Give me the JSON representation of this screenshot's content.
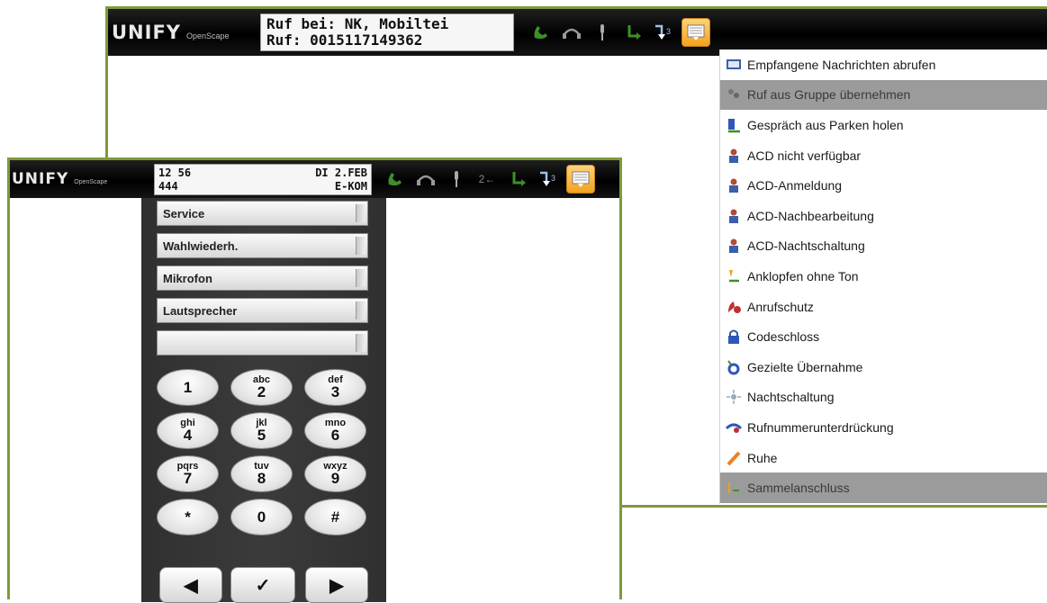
{
  "back_window": {
    "logo_brand": "UNIFY",
    "logo_sub": "OpenScape",
    "display": [
      "Ruf bei: NK, Mobiltei",
      "Ruf: 0015117149362"
    ],
    "toolbar_icons": [
      "phone-handset-icon",
      "headset-icon",
      "microphone-icon",
      "call-transfer-icon",
      "call-forward-icon",
      "menu-icon"
    ]
  },
  "dropdown_menu": {
    "items": [
      {
        "label": "Empfangene Nachrichten abrufen",
        "icon": "messages-icon",
        "enabled": true
      },
      {
        "label": "Ruf aus Gruppe übernehmen",
        "icon": "group-pickup-icon",
        "enabled": false
      },
      {
        "label": "Gespräch aus Parken holen",
        "icon": "park-retrieve-icon",
        "enabled": true
      },
      {
        "label": "ACD nicht verfügbar",
        "icon": "acd-agent-icon",
        "enabled": true
      },
      {
        "label": "ACD-Anmeldung",
        "icon": "acd-agent-icon",
        "enabled": true
      },
      {
        "label": "ACD-Nachbearbeitung",
        "icon": "acd-agent-icon",
        "enabled": true
      },
      {
        "label": "ACD-Nachtschaltung",
        "icon": "acd-agent-icon",
        "enabled": true
      },
      {
        "label": "Anklopfen ohne Ton",
        "icon": "call-waiting-icon",
        "enabled": true
      },
      {
        "label": "Anrufschutz",
        "icon": "do-not-disturb-icon",
        "enabled": true
      },
      {
        "label": "Codeschloss",
        "icon": "lock-icon",
        "enabled": true
      },
      {
        "label": "Gezielte Übernahme",
        "icon": "directed-pickup-icon",
        "enabled": true
      },
      {
        "label": "Nachtschaltung",
        "icon": "night-service-icon",
        "enabled": true
      },
      {
        "label": "Rufnummerunterdrückung",
        "icon": "suppress-number-icon",
        "enabled": true
      },
      {
        "label": "Ruhe",
        "icon": "silent-icon",
        "enabled": true
      },
      {
        "label": "Sammelanschluss",
        "icon": "hunt-group-icon",
        "enabled": false
      }
    ]
  },
  "front_window": {
    "logo_brand": "UNIFY",
    "logo_sub": "OpenScape",
    "display": {
      "time": "12 56",
      "date": "DI 2.FEB",
      "extension": "444",
      "label": "E-KOM"
    },
    "toolbar_num_label": "2←",
    "toolbar_icons": [
      "phone-handset-icon",
      "headset-icon",
      "microphone-icon",
      "number-arrow-icon",
      "call-transfer-icon",
      "call-forward-icon",
      "menu-icon"
    ]
  },
  "keypad": {
    "function_keys": [
      "Service",
      "Wahlwiederh.",
      "Mikrofon",
      "Lautsprecher",
      ""
    ],
    "digits": [
      {
        "main": "1",
        "sub": ""
      },
      {
        "main": "2",
        "sub": "abc"
      },
      {
        "main": "3",
        "sub": "def"
      },
      {
        "main": "4",
        "sub": "ghi"
      },
      {
        "main": "5",
        "sub": "jkl"
      },
      {
        "main": "6",
        "sub": "mno"
      },
      {
        "main": "7",
        "sub": "pqrs"
      },
      {
        "main": "8",
        "sub": "tuv"
      },
      {
        "main": "9",
        "sub": "wxyz"
      },
      {
        "main": "*",
        "sub": ""
      },
      {
        "main": "0",
        "sub": ""
      },
      {
        "main": "#",
        "sub": ""
      }
    ],
    "nav": [
      "◀",
      "✓",
      "▶"
    ]
  },
  "colors": {
    "border": "#7f9a3a",
    "titlebar": "#000000",
    "menu_disabled": "#9b9b9b",
    "menu_button": "#f3a21c"
  }
}
